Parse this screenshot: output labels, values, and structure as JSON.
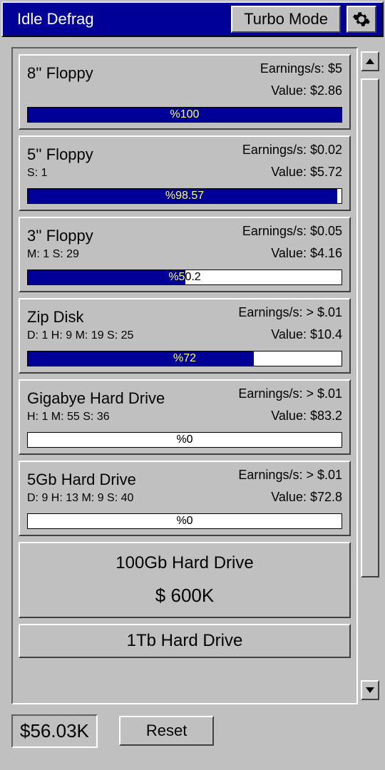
{
  "header": {
    "title": "Idle Defrag",
    "turbo_label": "Turbo Mode"
  },
  "drives": [
    {
      "name": "8'' Floppy",
      "earnings": "Earnings/s: $5",
      "value": "Value: $2.86",
      "timer": "",
      "progress_pct": 100,
      "progress_label": "%100"
    },
    {
      "name": "5'' Floppy",
      "earnings": "Earnings/s: $0.02",
      "value": "Value: $5.72",
      "timer": "S: 1",
      "progress_pct": 98.57,
      "progress_label": "%98.57"
    },
    {
      "name": "3'' Floppy",
      "earnings": "Earnings/s: $0.05",
      "value": "Value: $4.16",
      "timer": "M: 1 S: 29",
      "progress_pct": 50.2,
      "progress_label": "%50.2"
    },
    {
      "name": "Zip Disk",
      "earnings": "Earnings/s: > $.01",
      "value": "Value: $10.4",
      "timer": "D: 1 H: 9 M: 19 S: 25",
      "progress_pct": 72,
      "progress_label": "%72"
    },
    {
      "name": "Gigabye Hard Drive",
      "earnings": "Earnings/s: > $.01",
      "value": "Value: $83.2",
      "timer": "H: 1 M: 55 S: 36",
      "progress_pct": 0,
      "progress_label": "%0"
    },
    {
      "name": "5Gb Hard Drive",
      "earnings": "Earnings/s: > $.01",
      "value": "Value: $72.8",
      "timer": "D: 9 H: 13 M: 9 S: 40",
      "progress_pct": 0,
      "progress_label": "%0"
    }
  ],
  "locked": [
    {
      "name": "100Gb Hard Drive",
      "price": "$ 600K"
    },
    {
      "name": "1Tb Hard Drive",
      "price": ""
    }
  ],
  "footer": {
    "money": "$56.03K",
    "reset_label": "Reset"
  }
}
